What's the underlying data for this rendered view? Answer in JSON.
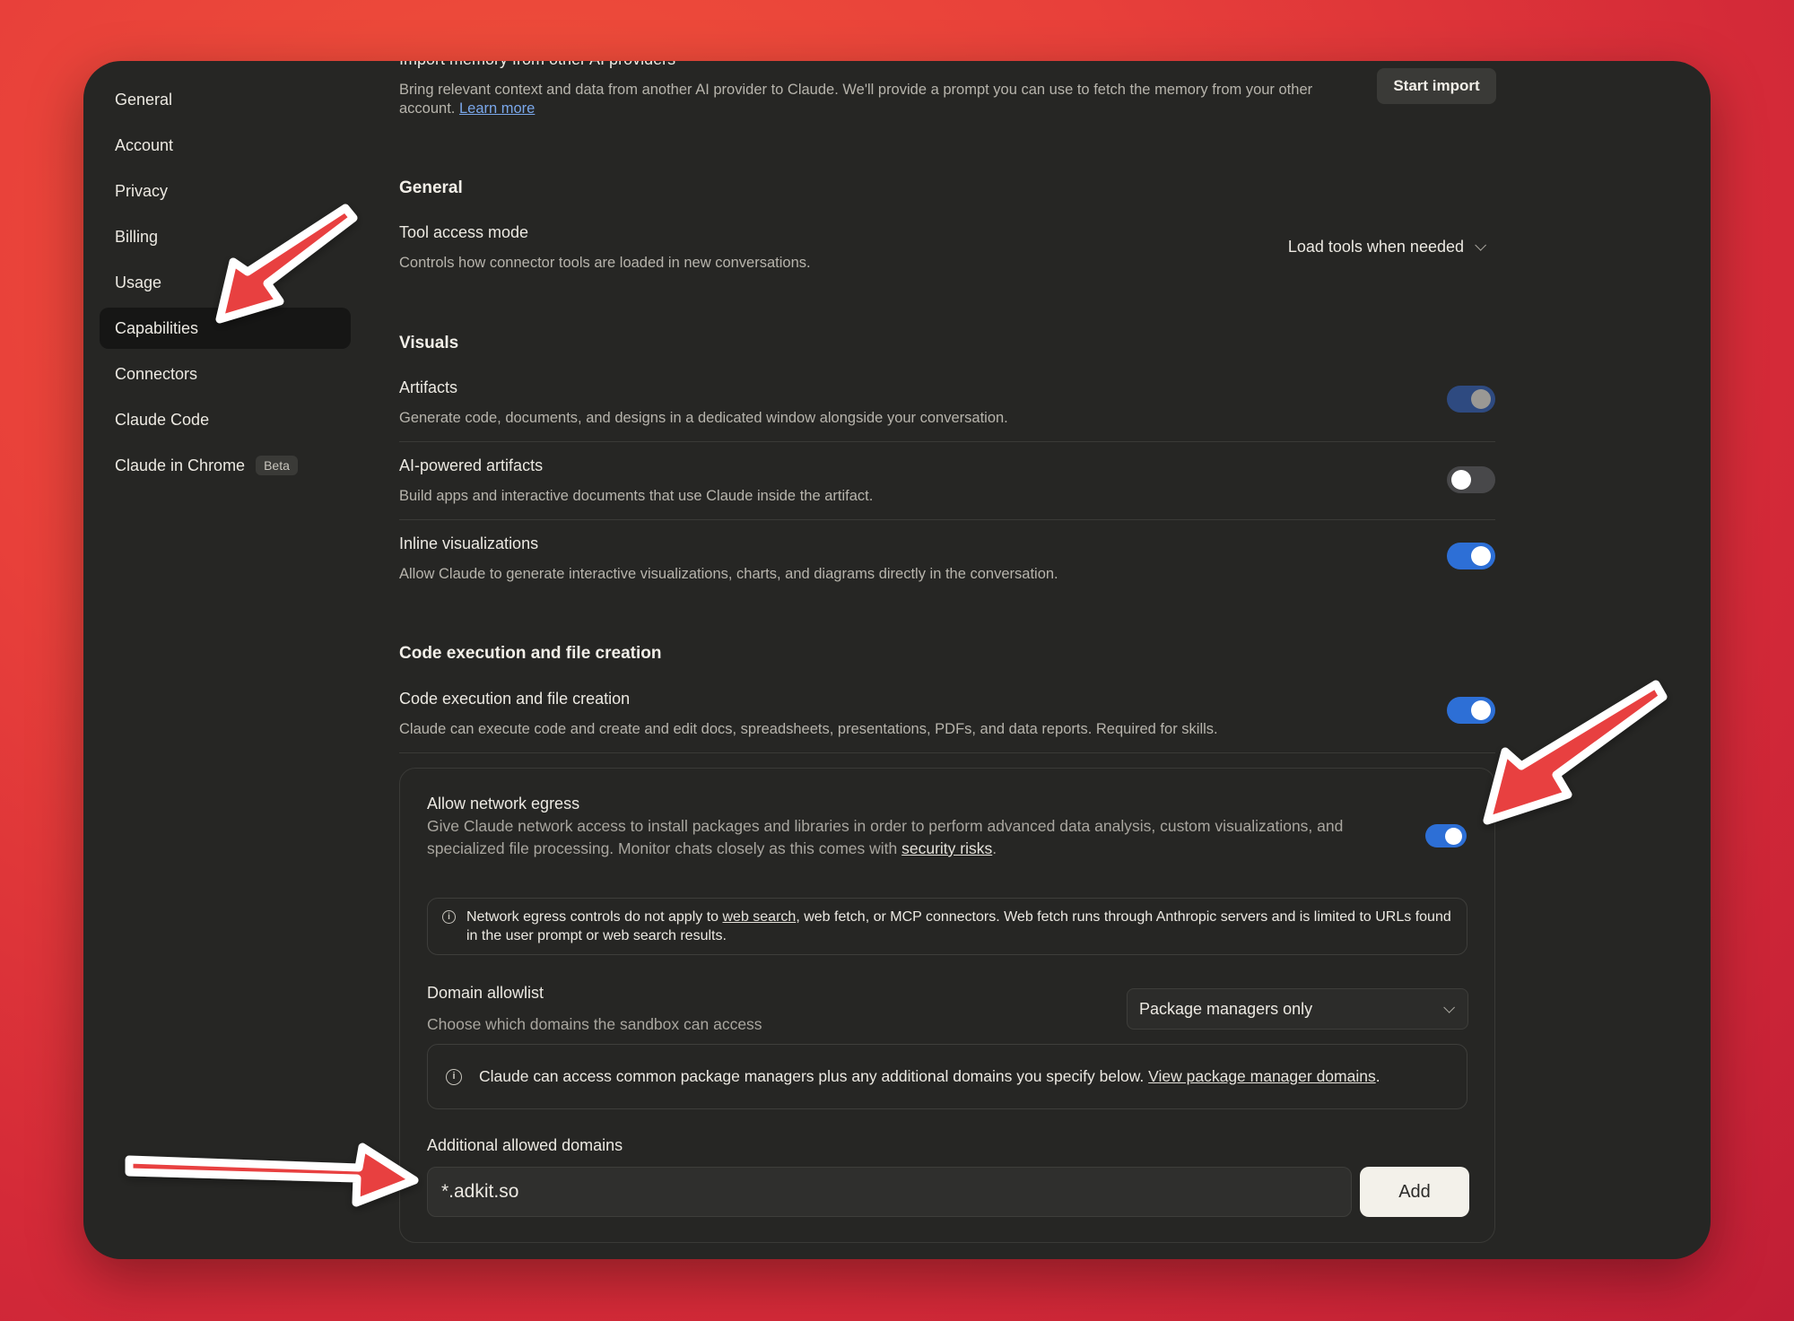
{
  "sidebar": {
    "items": [
      {
        "label": "General"
      },
      {
        "label": "Account"
      },
      {
        "label": "Privacy"
      },
      {
        "label": "Billing"
      },
      {
        "label": "Usage"
      },
      {
        "label": "Capabilities",
        "active": true
      },
      {
        "label": "Connectors"
      },
      {
        "label": "Claude Code"
      },
      {
        "label": "Claude in Chrome",
        "badge": "Beta"
      }
    ]
  },
  "import": {
    "title": "Import memory from other AI providers",
    "description": "Bring relevant context and data from another AI provider to Claude. We'll provide a prompt you can use to fetch the memory from your other account.",
    "learn_more": "Learn more",
    "button": "Start import"
  },
  "general": {
    "heading": "General",
    "tool_access": {
      "title": "Tool access mode",
      "description": "Controls how connector tools are loaded in new conversations.",
      "value": "Load tools when needed"
    }
  },
  "visuals": {
    "heading": "Visuals",
    "artifacts": {
      "title": "Artifacts",
      "description": "Generate code, documents, and designs in a dedicated window alongside your conversation.",
      "enabled": true
    },
    "ai_artifacts": {
      "title": "AI-powered artifacts",
      "description": "Build apps and interactive documents that use Claude inside the artifact.",
      "enabled": false
    },
    "inline_viz": {
      "title": "Inline visualizations",
      "description": "Allow Claude to generate interactive visualizations, charts, and diagrams directly in the conversation.",
      "enabled": true
    }
  },
  "code_exec": {
    "heading": "Code execution and file creation",
    "title": "Code execution and file creation",
    "description": "Claude can execute code and create and edit docs, spreadsheets, presentations, PDFs, and data reports. Required for skills.",
    "enabled": true
  },
  "egress": {
    "title": "Allow network egress",
    "description": "Give Claude network access to install packages and libraries in order to perform advanced data analysis, custom visualizations, and specialized file processing. Monitor chats closely as this comes with",
    "security_link": "security risks",
    "enabled": true,
    "note_pre": "Network egress controls do not apply to",
    "note_link": "web search",
    "note_post": ", web fetch, or MCP connectors. Web fetch runs through Anthropic servers and is limited to URLs found in the user prompt or web search results.",
    "allowlist_title": "Domain allowlist",
    "allowlist_desc": "Choose which domains the sandbox can access",
    "allowlist_value": "Package managers only",
    "pkg_note": "Claude can access common package managers plus any additional domains you specify below.",
    "pkg_link": "View package manager domains",
    "additional_title": "Additional allowed domains",
    "domain_value": "*.adkit.so",
    "add_button": "Add"
  },
  "colors": {
    "accent": "#2d6fd6",
    "background": "#262624",
    "arrow": "#e8403f"
  }
}
